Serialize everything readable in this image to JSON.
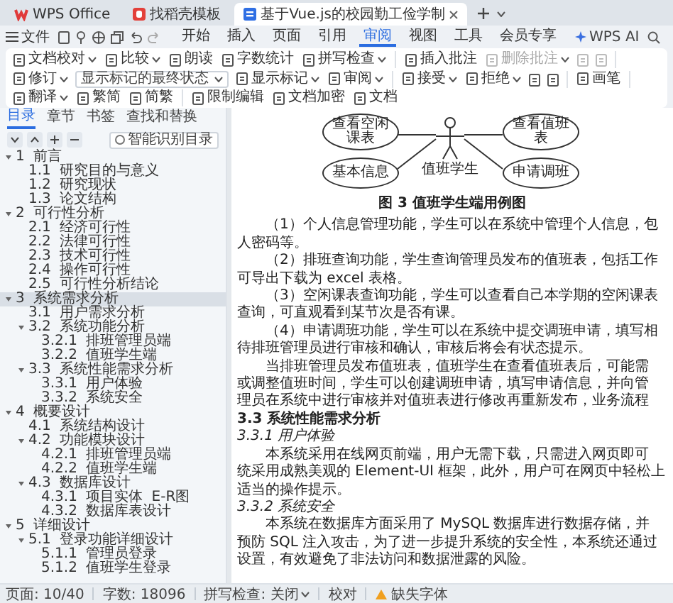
{
  "titlebar": {
    "tabs": [
      {
        "kind": "home",
        "label": "WPS Office",
        "selected": false
      },
      {
        "kind": "template",
        "label": "找稻壳模板",
        "selected": false
      },
      {
        "kind": "document",
        "label": "基于Vue.js的校园勤工俭学制",
        "selected": true
      }
    ]
  },
  "menubar": {
    "file": "文件",
    "tabs": [
      {
        "label": "开始",
        "selected": false
      },
      {
        "label": "插入",
        "selected": false
      },
      {
        "label": "页面",
        "selected": false
      },
      {
        "label": "引用",
        "selected": false
      },
      {
        "label": "审阅",
        "selected": true
      },
      {
        "label": "视图",
        "selected": false
      },
      {
        "label": "工具",
        "selected": false
      },
      {
        "label": "会员专享",
        "selected": false
      }
    ],
    "ai": "WPS AI"
  },
  "ribbon": {
    "groups": [
      [
        {
          "kind": "button",
          "label": "文档校对",
          "dropdown": true,
          "disabled": false
        },
        {
          "kind": "button",
          "label": "比较",
          "dropdown": true,
          "disabled": false
        },
        {
          "kind": "button",
          "label": "朗读",
          "dropdown": false,
          "disabled": false
        },
        {
          "kind": "button",
          "label": "字数统计",
          "dropdown": false,
          "disabled": false
        },
        {
          "kind": "button",
          "label": "拼写检查",
          "dropdown": true,
          "disabled": false
        }
      ],
      [
        {
          "kind": "button",
          "label": "插入批注",
          "dropdown": false,
          "disabled": false
        },
        {
          "kind": "button",
          "label": "删除批注",
          "dropdown": true,
          "disabled": true
        },
        {
          "kind": "icon",
          "disabled": true
        },
        {
          "kind": "icon",
          "disabled": true
        }
      ],
      [
        {
          "kind": "button",
          "label": "修订",
          "dropdown": true,
          "disabled": false
        },
        {
          "kind": "select",
          "value": "显示标记的最终状态"
        },
        {
          "kind": "button",
          "label": "显示标记",
          "dropdown": true,
          "disabled": false
        },
        {
          "kind": "button",
          "label": "审阅",
          "dropdown": true,
          "disabled": false
        }
      ],
      [
        {
          "kind": "button",
          "label": "接受",
          "dropdown": true,
          "disabled": false
        },
        {
          "kind": "button",
          "label": "拒绝",
          "dropdown": true,
          "disabled": false
        },
        {
          "kind": "icon",
          "disabled": false
        },
        {
          "kind": "icon",
          "disabled": false
        }
      ],
      [
        {
          "kind": "button",
          "label": "画笔",
          "dropdown": false,
          "disabled": false
        }
      ],
      [
        {
          "kind": "button",
          "label": "翻译",
          "dropdown": true,
          "disabled": false
        },
        {
          "kind": "button",
          "label": "繁简",
          "dropdown": false,
          "disabled": false
        },
        {
          "kind": "button",
          "label": "简繁",
          "dropdown": false,
          "disabled": false
        }
      ],
      [
        {
          "kind": "button",
          "label": "限制编辑",
          "dropdown": false,
          "disabled": false
        },
        {
          "kind": "button",
          "label": "文档加密",
          "dropdown": false,
          "disabled": false
        },
        {
          "kind": "button",
          "label": "文档",
          "dropdown": false,
          "disabled": false
        }
      ]
    ]
  },
  "toc": {
    "tabs": [
      {
        "label": "目录",
        "selected": true
      },
      {
        "label": "章节",
        "selected": false
      },
      {
        "label": "书签",
        "selected": false
      },
      {
        "label": "查找和替换",
        "selected": false
      }
    ],
    "smart_toc": {
      "label": "智能识别目录",
      "checked": false
    },
    "items": [
      {
        "label": "1 前言",
        "selected": false,
        "expanded": true,
        "children": [
          {
            "label": "1.1 研究目的与意义",
            "selected": false
          },
          {
            "label": "1.2 研究现状",
            "selected": false
          },
          {
            "label": "1.3 论文结构",
            "selected": false
          }
        ]
      },
      {
        "label": "2 可行性分析",
        "selected": false,
        "expanded": true,
        "children": [
          {
            "label": "2.1 经济可行性",
            "selected": false
          },
          {
            "label": "2.2 法律可行性",
            "selected": false
          },
          {
            "label": "2.3 技术可行性",
            "selected": false
          },
          {
            "label": "2.4 操作可行性",
            "selected": false
          },
          {
            "label": "2.5 可行性分析结论",
            "selected": false
          }
        ]
      },
      {
        "label": "3 系统需求分析",
        "selected": true,
        "expanded": true,
        "children": [
          {
            "label": "3.1 用户需求分析",
            "selected": false
          },
          {
            "label": "3.2 系统功能分析",
            "selected": false,
            "expanded": true,
            "children": [
              {
                "label": "3.2.1 排班管理员端",
                "selected": false
              },
              {
                "label": "3.2.2 值班学生端",
                "selected": false
              }
            ]
          },
          {
            "label": "3.3 系统性能需求分析",
            "selected": false,
            "expanded": true,
            "children": [
              {
                "label": "3.3.1 用户体验",
                "selected": false
              },
              {
                "label": "3.3.2 系统安全",
                "selected": false
              }
            ]
          }
        ]
      },
      {
        "label": "4 概要设计",
        "selected": false,
        "expanded": true,
        "children": [
          {
            "label": "4.1 系统结构设计",
            "selected": false
          },
          {
            "label": "4.2 功能模块设计",
            "selected": false,
            "expanded": true,
            "children": [
              {
                "label": "4.2.1 排班管理员端",
                "selected": false
              },
              {
                "label": "4.2.2 值班学生端",
                "selected": false
              }
            ]
          },
          {
            "label": "4.3 数据库设计",
            "selected": false,
            "expanded": true,
            "children": [
              {
                "label": "4.3.1 项目实体 E-R图",
                "selected": false
              },
              {
                "label": "4.3.2 数据库表设计",
                "selected": false
              }
            ]
          }
        ]
      },
      {
        "label": "5 详细设计",
        "selected": false,
        "expanded": true,
        "children": [
          {
            "label": "5.1 登录功能详细设计",
            "selected": false,
            "expanded": true,
            "children": [
              {
                "label": "5.1.1 管理员登录",
                "selected": false
              },
              {
                "label": "5.1.2 值班学生登录",
                "selected": false
              }
            ]
          }
        ]
      }
    ]
  },
  "document": {
    "figure": {
      "actor": "值班学生",
      "use_cases": [
        {
          "label": "查看空闲课表"
        },
        {
          "label": "查看值班表"
        },
        {
          "label": "基本信息"
        },
        {
          "label": "申请调班"
        }
      ],
      "caption": "图 3 值班学生端用例图"
    },
    "blocks": [
      {
        "kind": "paragraph",
        "lines": [
          "（1）个人信息管理功能，学生可以在系统中管理个人信息，包",
          "人密码等。"
        ]
      },
      {
        "kind": "paragraph",
        "lines": [
          "（2）排班查询功能，学生查询管理员发布的值班表，包括工作",
          "可导出下载为 excel 表格。"
        ]
      },
      {
        "kind": "paragraph",
        "lines": [
          "（3）空闲课表查询功能，学生可以查看自己本学期的空闲课表",
          "查询，可直观看到某节次是否有课。"
        ]
      },
      {
        "kind": "paragraph",
        "lines": [
          "（4）申请调班功能，学生可以在系统中提交调班申请，填写相",
          "待排班管理员进行审核和确认，审核后将会有状态提示。"
        ]
      },
      {
        "kind": "paragraph",
        "lines": [
          "当排班管理员发布值班表，值班学生在查看值班表后，可能需",
          "或调整值班时间，学生可以创建调班申请，填写申请信息，并向管",
          "理员在系统中进行审核并对值班表进行修改再重新发布，业务流程"
        ]
      },
      {
        "kind": "heading",
        "text": "3.3 系统性能需求分析"
      },
      {
        "kind": "subheading",
        "text": "3.3.1 用户体验"
      },
      {
        "kind": "paragraph",
        "lines": [
          "本系统采用在线网页前端，用户无需下载，只需进入网页即可",
          "统采用成熟美观的 Element-UI 框架，此外，用户可在网页中轻松上",
          "适当的操作提示。"
        ]
      },
      {
        "kind": "subheading",
        "text": "3.3.2 系统安全"
      },
      {
        "kind": "paragraph",
        "lines": [
          "本系统在数据库方面采用了 MySQL 数据库进行数据存储，并",
          "预防 SQL 注入攻击，为了进一步提升系统的安全性，本系统还通过",
          "设置，有效避免了非法访问和数据泄露的风险。"
        ]
      }
    ]
  },
  "status_bar": {
    "page": "页面: 10/40",
    "words": "字数: 18096",
    "spell_check": "拼写检查: 关闭",
    "proofread": "校对",
    "missing_fonts": "缺失字体"
  }
}
